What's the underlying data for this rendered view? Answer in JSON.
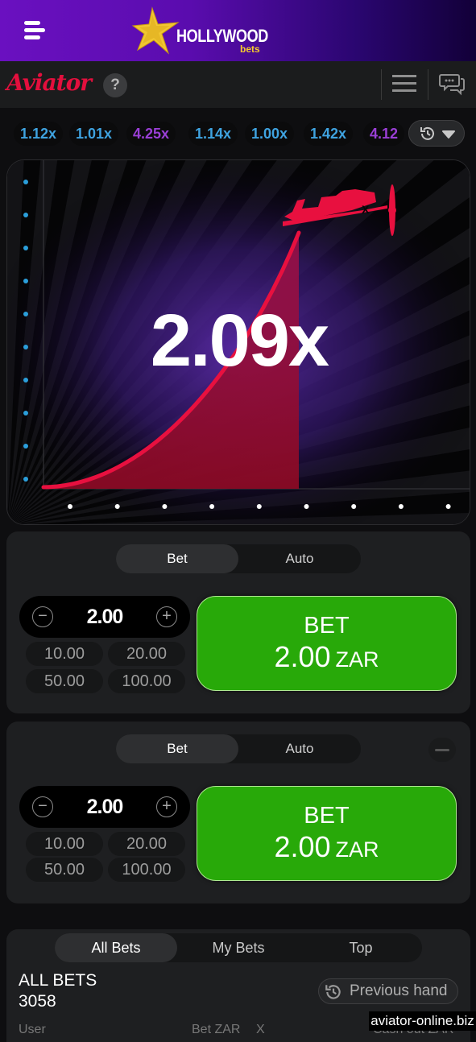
{
  "topbar": {
    "brand_name": "HOLLYWOOD",
    "brand_sub": "bets",
    "menu_icon": "hamburger-icon",
    "logo_icon": "star-logo-icon"
  },
  "appbar": {
    "game_title": "Aviator",
    "help_label": "?",
    "menu_icon": "menu-icon",
    "chat_icon": "chat-icon"
  },
  "history": {
    "items": [
      {
        "value": "1.12x",
        "color": "#3fa3e0"
      },
      {
        "value": "1.01x",
        "color": "#3fa3e0"
      },
      {
        "value": "4.25x",
        "color": "#9a3fd6"
      },
      {
        "value": "1.14x",
        "color": "#3fa3e0"
      },
      {
        "value": "1.00x",
        "color": "#3fa3e0"
      },
      {
        "value": "1.42x",
        "color": "#3fa3e0"
      },
      {
        "value": "4.12",
        "color": "#9a3fd6"
      }
    ],
    "toggle_icons": [
      "history-icon",
      "chevron-down-icon"
    ]
  },
  "game": {
    "multiplier": "2.09x",
    "curve_color": "#e8103f",
    "y_axis_dot_color": "#2b9fdb",
    "x_axis_dot_color": "#ffffff"
  },
  "bet_panels": [
    {
      "tabs": [
        "Bet",
        "Auto"
      ],
      "active_tab": "Bet",
      "amount": "2.00",
      "quick_amounts": [
        "10.00",
        "20.00",
        "50.00",
        "100.00"
      ],
      "button_label": "BET",
      "button_amount": "2.00",
      "currency": "ZAR",
      "removable": false
    },
    {
      "tabs": [
        "Bet",
        "Auto"
      ],
      "active_tab": "Bet",
      "amount": "2.00",
      "quick_amounts": [
        "10.00",
        "20.00",
        "50.00",
        "100.00"
      ],
      "button_label": "BET",
      "button_amount": "2.00",
      "currency": "ZAR",
      "removable": true
    }
  ],
  "bets_list": {
    "tabs": [
      "All Bets",
      "My Bets",
      "Top"
    ],
    "active_tab": "All Bets",
    "title": "ALL BETS",
    "count": "3058",
    "previous_hand_label": "Previous hand",
    "columns": [
      "User",
      "Bet ZAR",
      "X",
      "Cash out ZAR"
    ]
  },
  "watermark": "aviator-online.biz",
  "colors": {
    "brand_purple": "#6a10c0",
    "aviator_red": "#e30f3d",
    "bet_green": "#28a909"
  }
}
